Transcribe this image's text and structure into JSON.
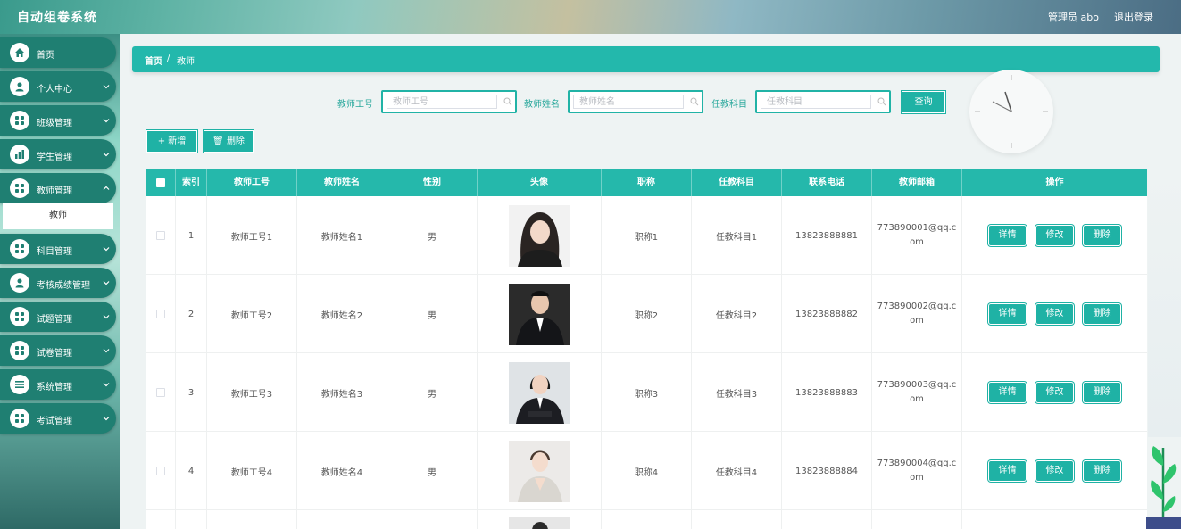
{
  "header": {
    "title": "自动组卷系统",
    "admin": "管理员 abo",
    "logout": "退出登录"
  },
  "sidebar": {
    "items": [
      {
        "label": "首页",
        "icon": "home-icon"
      },
      {
        "label": "个人中心",
        "icon": "user-icon"
      },
      {
        "label": "班级管理",
        "icon": "grid-icon"
      },
      {
        "label": "学生管理",
        "icon": "chart-icon"
      },
      {
        "label": "教师管理",
        "icon": "grid-icon"
      },
      {
        "label": "科目管理",
        "icon": "grid-icon"
      },
      {
        "label": "考核成绩管理",
        "icon": "user-icon"
      },
      {
        "label": "试题管理",
        "icon": "grid-icon"
      },
      {
        "label": "试卷管理",
        "icon": "grid-icon"
      },
      {
        "label": "系统管理",
        "icon": "list-icon"
      },
      {
        "label": "考试管理",
        "icon": "grid-icon"
      }
    ],
    "active_sub": "教师"
  },
  "breadcrumb": {
    "home": "首页",
    "sep": "/",
    "current": "教师"
  },
  "search": {
    "fields": [
      {
        "label": "教师工号",
        "placeholder": "教师工号"
      },
      {
        "label": "教师姓名",
        "placeholder": "教师姓名"
      },
      {
        "label": "任教科目",
        "placeholder": "任教科目"
      }
    ],
    "query_label": "查询"
  },
  "actions": {
    "add_label": "+ 新增",
    "delete_label": "删除"
  },
  "table": {
    "headers": [
      "索引",
      "教师工号",
      "教师姓名",
      "性别",
      "头像",
      "职称",
      "任教科目",
      "联系电话",
      "教师邮箱",
      "操作"
    ],
    "rows": [
      {
        "index": "1",
        "id": "教师工号1",
        "name": "教师姓名1",
        "gender": "男",
        "title": "职称1",
        "subject": "任教科目1",
        "phone": "13823888881",
        "email_a": "773890001@qq.c",
        "email_b": "om"
      },
      {
        "index": "2",
        "id": "教师工号2",
        "name": "教师姓名2",
        "gender": "男",
        "title": "职称2",
        "subject": "任教科目2",
        "phone": "13823888882",
        "email_a": "773890002@qq.c",
        "email_b": "om"
      },
      {
        "index": "3",
        "id": "教师工号3",
        "name": "教师姓名3",
        "gender": "男",
        "title": "职称3",
        "subject": "任教科目3",
        "phone": "13823888883",
        "email_a": "773890003@qq.c",
        "email_b": "om"
      },
      {
        "index": "4",
        "id": "教师工号4",
        "name": "教师姓名4",
        "gender": "男",
        "title": "职称4",
        "subject": "任教科目4",
        "phone": "13823888884",
        "email_a": "773890004@qq.c",
        "email_b": "om"
      }
    ],
    "row_buttons": {
      "detail": "详情",
      "edit": "修改",
      "delete": "删除"
    }
  },
  "colors": {
    "accent": "#1fb2a5",
    "sidebar_item": "#1f7f72",
    "header_table": "#25b8ab"
  }
}
